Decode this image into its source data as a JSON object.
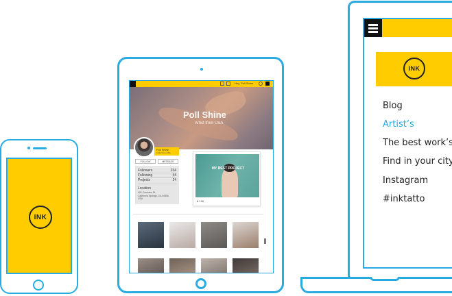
{
  "brand": {
    "logo_text": "INK",
    "accent": "#ffcc00",
    "device_color": "#29abe2"
  },
  "tablet": {
    "topbar": {
      "user": "Hey, Poll Shine"
    },
    "hero": {
      "name": "Poll Shine",
      "subtitle": "Artist from USA"
    },
    "namebar": {
      "name": "Poll Shine",
      "sub": "Artist from USA"
    },
    "buttons": {
      "follow": "FOLLOW",
      "message": "MESSAGE"
    },
    "stats": [
      {
        "label": "Followers",
        "value": "234"
      },
      {
        "label": "Following",
        "value": "44"
      },
      {
        "label": "Projects",
        "value": "24"
      }
    ],
    "location": {
      "label": "Location",
      "lines": [
        "401 Cunhaus St.",
        "California Springs, CA 90806",
        "USA"
      ]
    },
    "featured": {
      "title": "MY BEST PROJECT",
      "likes": "♥ 198"
    }
  },
  "laptop": {
    "menu": [
      "Blog",
      "Artist’s",
      "The best work’s",
      "Find in your city",
      "Instagram",
      "#inktatto"
    ],
    "active_index": 1
  }
}
